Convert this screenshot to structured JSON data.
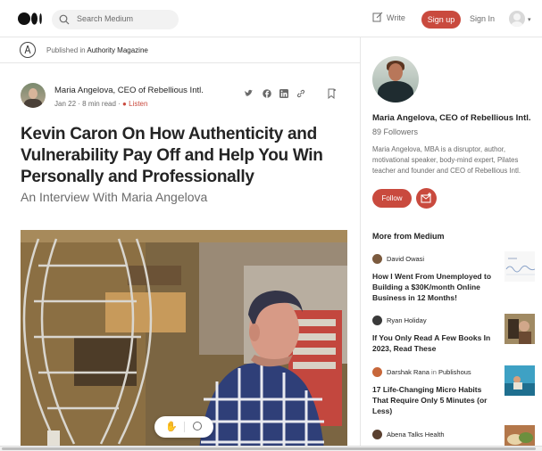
{
  "topbar": {
    "search_placeholder": "Search Medium",
    "write_label": "Write",
    "signup_label": "Sign up",
    "signin_label": "Sign In"
  },
  "publication": {
    "prefix": "Published in",
    "name": "Authority Magazine"
  },
  "article": {
    "author": "Maria Angelova, CEO of Rebellious Intl.",
    "date": "Jan 22",
    "read_time": "8 min read",
    "listen_label": "Listen",
    "title": "Kevin Caron On How Authenticity and Vulnerability Pay Off and Help You Win Personally and Professionally",
    "subtitle": "An Interview With Maria Angelova"
  },
  "sidebar": {
    "author_name": "Maria Angelova, CEO of Rebellious Intl.",
    "followers": "89 Followers",
    "bio": "Maria Angelova, MBA is a disruptor, author, motivational speaker, body-mind expert, Pilates teacher and founder and CEO of Rebellious Intl.",
    "follow_label": "Follow",
    "more_heading": "More from Medium",
    "stories": [
      {
        "author": "David Owasi",
        "pub": "",
        "title": "How I Went From Unemployed to Building a $30K/month Online Business in 12 Months!"
      },
      {
        "author": "Ryan Holiday",
        "pub": "",
        "title": "If You Only Read A Few Books In 2023, Read These"
      },
      {
        "author": "Darshak Rana",
        "pub_prefix": "in",
        "pub": "Publishous",
        "title": "17 Life-Changing Micro Habits That Require Only 5 Minutes (or Less)"
      },
      {
        "author": "Abena Talks Health",
        "pub": "",
        "title": ""
      }
    ]
  },
  "colors": {
    "accent": "#c94a3e",
    "text_primary": "#242424",
    "text_secondary": "#6b6b6b"
  },
  "icons": [
    "medium-logo-icon",
    "search-icon",
    "write-icon",
    "user-avatar-icon",
    "twitter-icon",
    "facebook-icon",
    "linkedin-icon",
    "link-icon",
    "bookmark-icon",
    "play-icon",
    "clap-icon",
    "comment-icon",
    "subscribe-mail-icon"
  ]
}
